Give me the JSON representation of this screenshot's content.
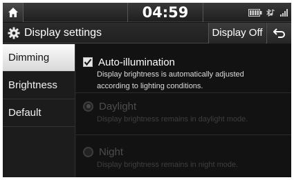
{
  "status_bar": {
    "time": "04:59",
    "icons": [
      "battery-icon",
      "bluetooth-audio-icon",
      "signal-icon"
    ]
  },
  "header": {
    "title": "Display settings",
    "display_off_label": "Display Off",
    "icons": [
      "gear-icon",
      "back-arrow-icon",
      "home-icon"
    ]
  },
  "sidebar": {
    "items": [
      {
        "label": "Dimming",
        "active": true
      },
      {
        "label": "Brightness",
        "active": false
      },
      {
        "label": "Default",
        "active": false
      }
    ]
  },
  "main": {
    "options": [
      {
        "type": "checkbox",
        "checked": true,
        "enabled": true,
        "label": "Auto-illumination",
        "description_lines": [
          "Display brightness is automatically adjusted",
          "according to lighting conditions."
        ]
      },
      {
        "type": "radio",
        "selected": true,
        "enabled": false,
        "label": "Daylight",
        "description": "Display brightness remains in daylight mode."
      },
      {
        "type": "radio",
        "selected": false,
        "enabled": false,
        "label": "Night",
        "description": "Display brightness remains in night mode."
      }
    ]
  },
  "colors": {
    "background": "#161616",
    "selected_tab": "#e8e8e8",
    "disabled_text": "#4d4d4d"
  }
}
